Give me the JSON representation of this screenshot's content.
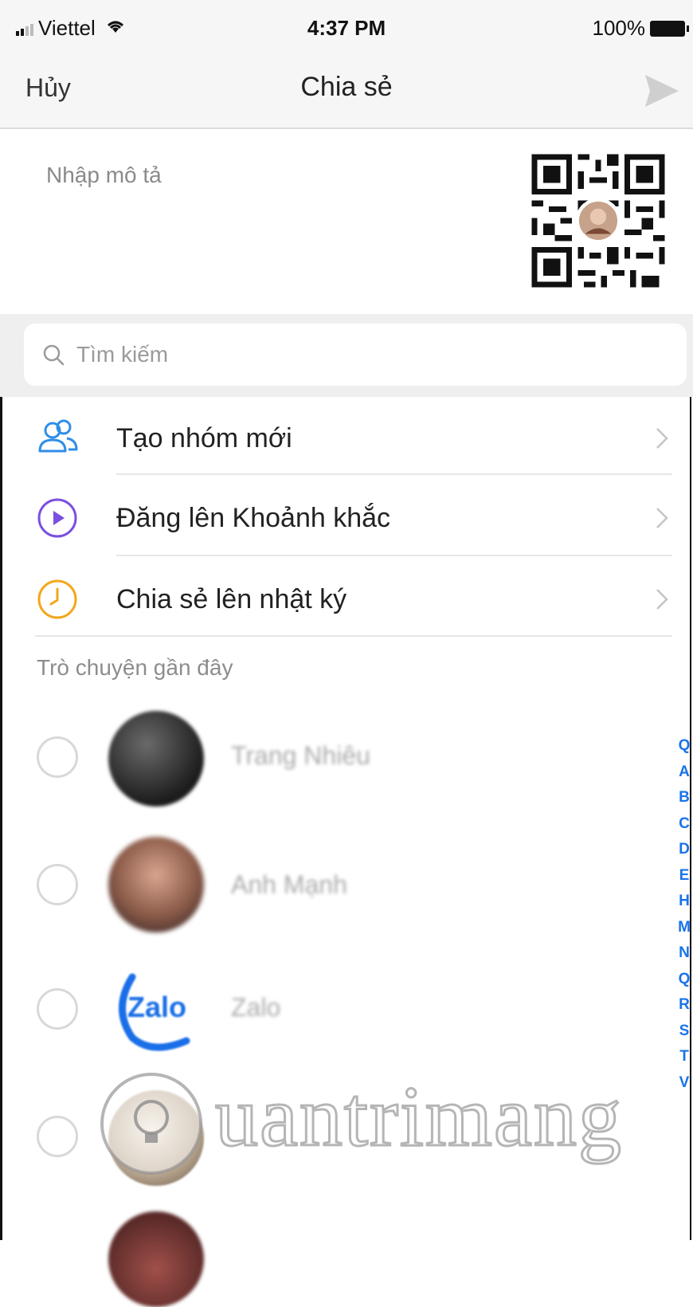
{
  "status_bar": {
    "carrier": "Viettel",
    "time": "4:37 PM",
    "battery": "100%"
  },
  "nav": {
    "cancel_label": "Hủy",
    "title": "Chia sẻ",
    "send_icon": "send-icon"
  },
  "description": {
    "placeholder": "Nhập mô tả"
  },
  "search": {
    "placeholder": "Tìm kiếm"
  },
  "actions": [
    {
      "label": "Tạo nhóm mới",
      "icon": "group-icon",
      "color": "#2f8ee8"
    },
    {
      "label": "Đăng lên Khoảnh khắc",
      "icon": "play-circle-icon",
      "color": "#7b4fe0"
    },
    {
      "label": "Chia sẻ lên nhật ký",
      "icon": "clock-icon",
      "color": "#f2a81d"
    }
  ],
  "recent": {
    "title": "Trò chuyện gần đây",
    "contacts": [
      {
        "name": "Trang Nhiêu"
      },
      {
        "name": "Anh Mạnh"
      },
      {
        "name": "Zalo"
      },
      {
        "name": ""
      }
    ]
  },
  "alphabet_index": [
    "Q",
    "A",
    "B",
    "C",
    "D",
    "E",
    "H",
    "M",
    "N",
    "Q",
    "R",
    "S",
    "T",
    "V"
  ],
  "watermark": "uantrimang",
  "colors": {
    "accent": "#1a73e8",
    "nav_bg": "#f6f6f6"
  }
}
